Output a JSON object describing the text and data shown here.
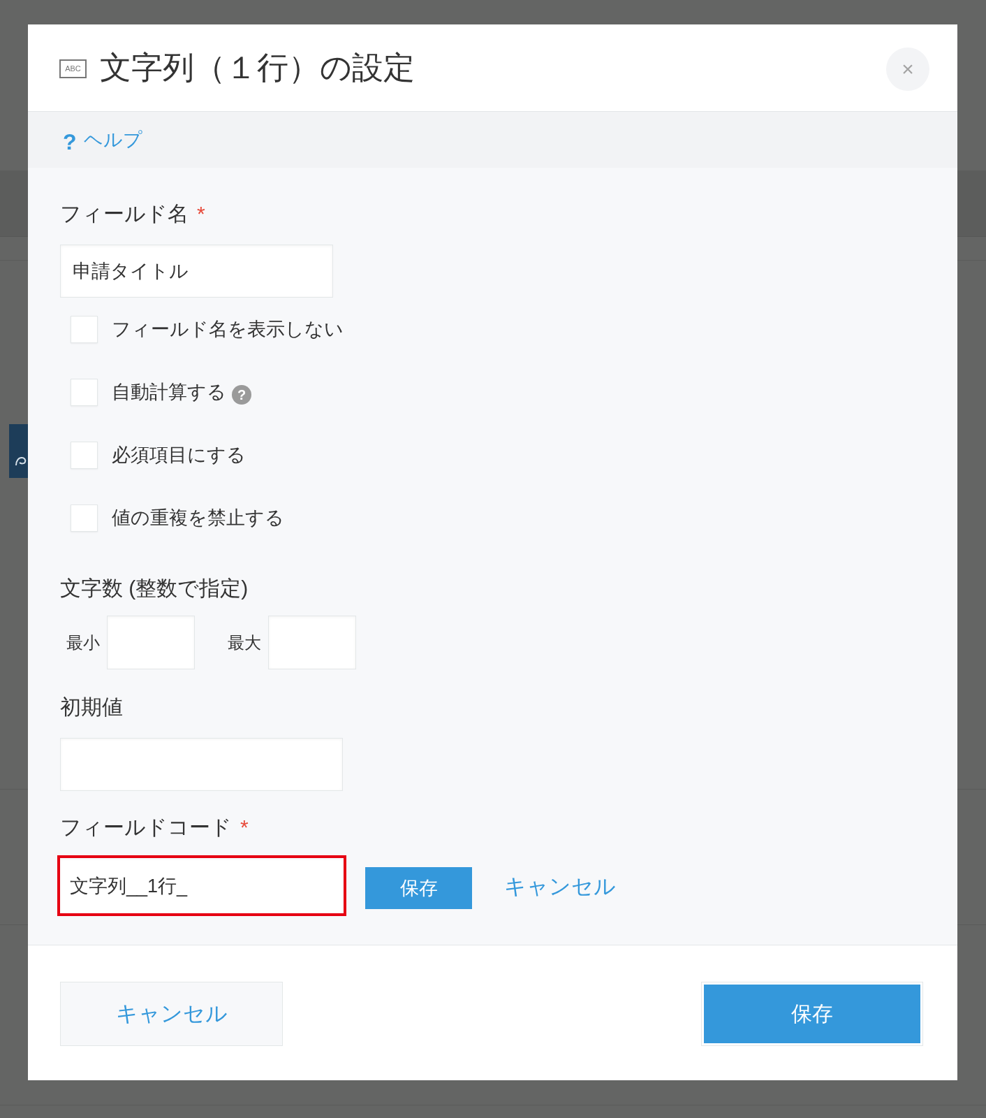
{
  "dialog": {
    "title_icon": "ABC",
    "title": "文字列（１行）の設定",
    "close": "×"
  },
  "help": {
    "icon": "?",
    "label": "ヘルプ"
  },
  "field_name": {
    "label": "フィールド名",
    "required_mark": "*",
    "value": "申請タイトル"
  },
  "options": [
    {
      "label": "フィールド名を表示しない",
      "checked": false
    },
    {
      "label": "自動計算する",
      "checked": false,
      "help_icon": "?"
    },
    {
      "label": "必須項目にする",
      "checked": false
    },
    {
      "label": "値の重複を禁止する",
      "checked": false
    }
  ],
  "char_count": {
    "label": "文字数 (整数で指定)",
    "min_label": "最小",
    "max_label": "最大"
  },
  "default_value": {
    "label": "初期値"
  },
  "field_code": {
    "label": "フィールドコード",
    "required_mark": "*",
    "value": "文字列__1行_",
    "highlighted": true,
    "actions": [
      {
        "label": "保存",
        "kind": "button"
      },
      {
        "label": "キャンセル",
        "kind": "link"
      }
    ]
  },
  "footer": {
    "buttons": [
      {
        "label": "キャンセル",
        "kind": "secondary"
      },
      {
        "label": "保存",
        "kind": "primary"
      }
    ]
  }
}
